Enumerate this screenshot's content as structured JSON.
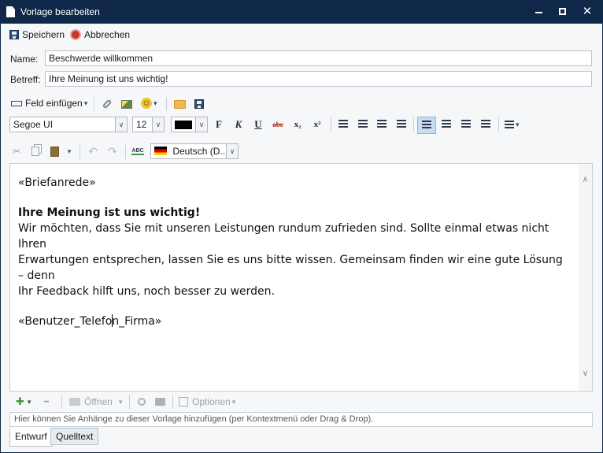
{
  "window": {
    "title": "Vorlage bearbeiten",
    "minimize": "–",
    "close": "✕"
  },
  "toolbar": {
    "save_label": "Speichern",
    "cancel_label": "Abbrechen"
  },
  "fields": {
    "name_label": "Name:",
    "name_value": "Beschwerde willkommen",
    "subject_label": "Betreff:",
    "subject_value": "Ihre Meinung ist uns wichtig!"
  },
  "insert_toolbar": {
    "insert_field_label": "Feld einfügen",
    "dropdown_glyph": "▾",
    "smiley": "☺"
  },
  "format_toolbar": {
    "font_family": "Segoe UI",
    "font_size": "12",
    "bold": "F",
    "italic": "K",
    "underline": "U",
    "strike": "abc",
    "subscript": "x₂",
    "superscript": "x²",
    "combo_arrow": "∨"
  },
  "edit_toolbar": {
    "language": "Deutsch (D...",
    "spell_label": "ABC"
  },
  "editor": {
    "salutation": "«Briefanrede»",
    "heading": "Ihre Meinung ist uns wichtig!",
    "body_line1": "Wir möchten, dass Sie mit unseren Leistungen rundum zufrieden sind. Sollte einmal etwas nicht Ihren",
    "body_line2": "Erwartungen entsprechen, lassen Sie es uns bitte wissen. Gemeinsam finden wir eine gute Lösung – denn",
    "body_line3": "Ihr Feedback hilft uns, noch besser zu werden.",
    "placeholder_part1": "«Benutzer_Telefo",
    "placeholder_part2": "n_Firma»",
    "scroll_up": "∧",
    "scroll_down": "∨"
  },
  "attachments": {
    "add": "✚",
    "remove": "━",
    "open_label": "Öffnen",
    "options_label": "Optionen",
    "hint": "Hier können Sie Anhänge zu dieser Vorlage hinzufügen (per Kontextmenü oder Drag & Drop)."
  },
  "tabs": [
    {
      "label": "Entwurf"
    },
    {
      "label": "Quelltext"
    }
  ]
}
